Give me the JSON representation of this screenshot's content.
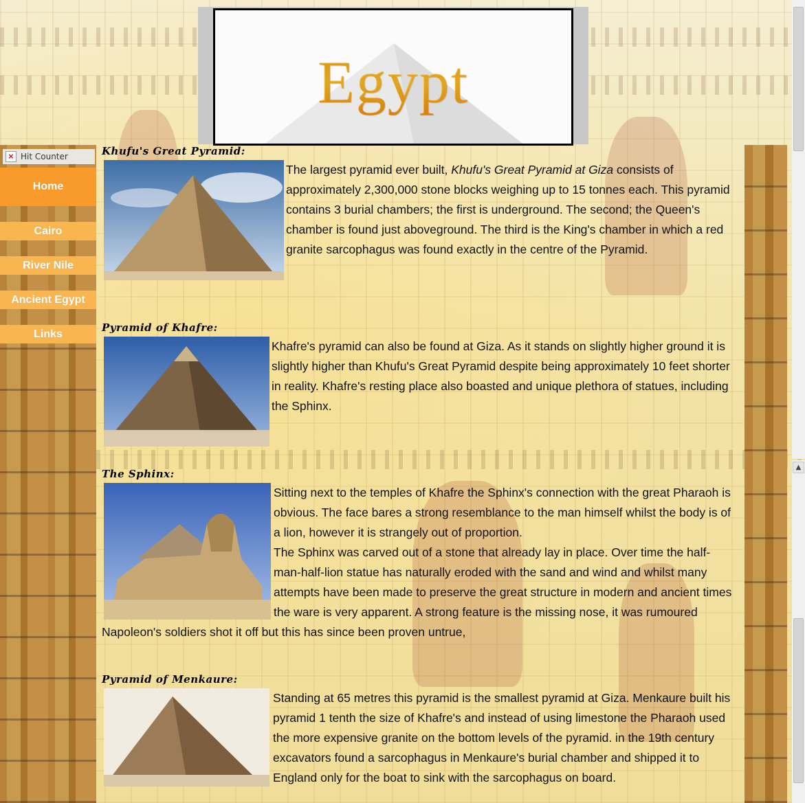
{
  "header": {
    "title": "Egypt"
  },
  "sidebar": {
    "hit_counter": "Hit Counter",
    "nav": [
      {
        "label": "Home"
      },
      {
        "label": "Cairo"
      },
      {
        "label": "River Nile"
      },
      {
        "label": "Ancient Egypt"
      },
      {
        "label": "Links"
      }
    ]
  },
  "sections": [
    {
      "title": "Khufu's Great Pyramid:",
      "text_pre": "The largest pyramid ever built, ",
      "text_em": "Khufu's Great Pyramid at Giza",
      "text_post": " consists of approximately 2,300,000 stone blocks weighing up to 15 tonnes each. This pyramid contains 3 burial chambers; the first is underground. The second; the Queen's chamber is found just aboveground. The third is the King's chamber in which a red granite sarcophagus was found exactly in the centre of the Pyramid."
    },
    {
      "title": "Pyramid of Khafre:",
      "text": "Khafre's pyramid can also be found at Giza. As it stands on slightly higher ground it is slightly higher than Khufu's Great Pyramid despite being approximately 10 feet shorter in reality. Khafre's resting place also boasted and unique plethora of statues, including the Sphinx."
    },
    {
      "title": "The Sphinx:",
      "text": "Sitting next to the temples of Khafre the Sphinx's connection with the great Pharaoh is obvious. The face bares a strong resemblance to the man himself whilst the body is of a lion, however it is strangely out of proportion.",
      "text2": "The Sphinx was carved out of a stone that already lay in place. Over time the half-man-half-lion statue has naturally eroded with the sand and wind and whilst many attempts have been made to preserve the great structure in modern and ancient times the ware is very apparent. A strong feature is the missing nose, it was rumoured Napoleon's soldiers shot it off but this has since been proven untrue,"
    },
    {
      "title": "Pyramid of Menkaure:",
      "text": "Standing at 65 metres this pyramid is the smallest pyramid at Giza.  Menkaure built his pyramid 1 tenth the size of Khafre's and instead of using limestone the Pharaoh used the more expensive granite on the bottom levels of the pyramid. in the 19th century excavators found a sarcophagus in Menkaure's burial chamber and shipped it to England only for the boat to sink with the sarcophagus on board."
    }
  ]
}
